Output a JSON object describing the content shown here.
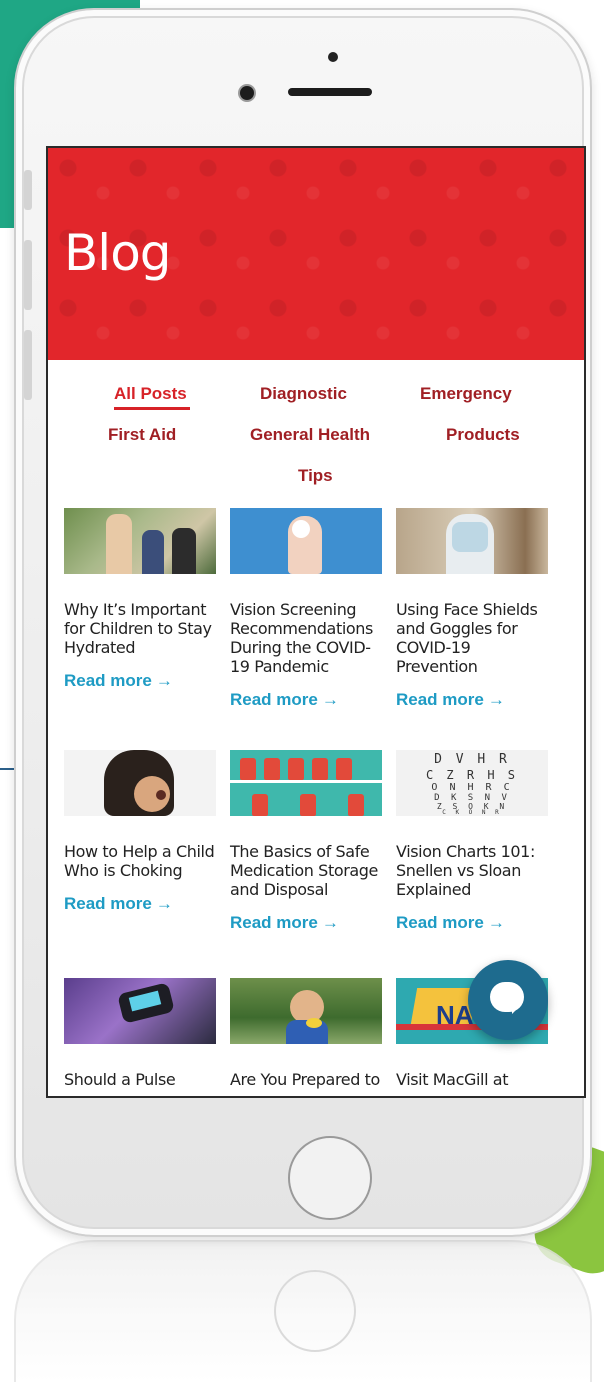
{
  "blog": {
    "title": "Blog"
  },
  "tabs": [
    {
      "label": "All Posts",
      "active": true
    },
    {
      "label": "Diagnostic"
    },
    {
      "label": "Emergency"
    },
    {
      "label": "First Aid"
    },
    {
      "label": "General Health"
    },
    {
      "label": "Products"
    },
    {
      "label": "Tips"
    }
  ],
  "posts": [
    {
      "title": "Why It’s Important for Children to Stay Hydrated",
      "read_more": "Read more",
      "arrow": "→"
    },
    {
      "title": "Vision Screening Recommendations During the COVID-19 Pandemic",
      "read_more": "Read more",
      "arrow": "→"
    },
    {
      "title": "Using Face Shields and Goggles for COVID-19 Prevention",
      "read_more": "Read more",
      "arrow": "→"
    },
    {
      "title": "How to Help a Child Who is Choking",
      "read_more": "Read more",
      "arrow": "→"
    },
    {
      "title": "The Basics of Safe Medication Storage and Disposal",
      "read_more": "Read more",
      "arrow": "→"
    },
    {
      "title": "Vision Charts 101: Snellen vs Sloan Explained",
      "read_more": "Read more",
      "arrow": "→"
    },
    {
      "title": "Should a Pulse",
      "read_more": "",
      "arrow": ""
    },
    {
      "title": "Are You Prepared to",
      "read_more": "",
      "arrow": ""
    },
    {
      "title": "Visit MacGill at",
      "read_more": "",
      "arrow": ""
    }
  ],
  "eye_chart": {
    "rows": [
      "D V H R",
      "C Z R H S",
      "O N H R C",
      "D K S N V",
      "Z S O K N",
      "C K O N R"
    ]
  },
  "nash_banner": {
    "text": "NAS"
  },
  "colors": {
    "accent": "#d72228",
    "link": "#1e9bc4",
    "hero": "#e2262b",
    "chat": "#1e6b8e"
  }
}
